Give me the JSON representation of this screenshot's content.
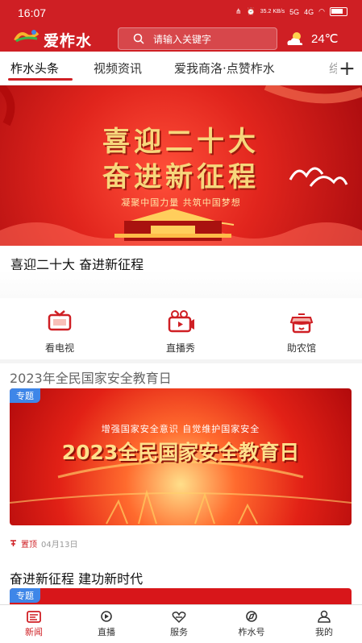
{
  "status": {
    "time": "16:07",
    "network_speed": "35.2 KB/s",
    "network_type": "5G",
    "signal_label": "4G"
  },
  "header": {
    "app_name": "爱柞水",
    "search_placeholder": "请输入关键字",
    "temperature": "24℃"
  },
  "tabs": [
    {
      "label": "柞水头条",
      "active": true
    },
    {
      "label": "视频资讯",
      "active": false
    },
    {
      "label": "爱我商洛·点赞柞水",
      "active": false
    },
    {
      "label": "综",
      "active": false
    }
  ],
  "hero": {
    "title_line_1": "喜迎二十大",
    "title_line_2": "奋进新征程",
    "subtitle": "凝聚中国力量  共筑中国梦想",
    "caption": "喜迎二十大 奋进新征程"
  },
  "quick_links": [
    {
      "label": "看电视",
      "icon": "tv-icon"
    },
    {
      "label": "直播秀",
      "icon": "camera-icon"
    },
    {
      "label": "助农馆",
      "icon": "shop-icon"
    }
  ],
  "feature": {
    "section_title": "2023年全民国家安全教育日",
    "tag": "专题",
    "subtitle": "增强国家安全意识  自觉维护国家安全",
    "title": "2023全民国家安全教育日",
    "pinned_label": "置顶",
    "date": "04月13日"
  },
  "next_item": {
    "title": "奋进新征程 建功新时代",
    "tag": "专题"
  },
  "bottom_nav": [
    {
      "label": "新闻",
      "active": true,
      "icon": "news-icon"
    },
    {
      "label": "直播",
      "active": false,
      "icon": "live-icon"
    },
    {
      "label": "服务",
      "active": false,
      "icon": "service-icon"
    },
    {
      "label": "柞水号",
      "active": false,
      "icon": "compass-icon"
    },
    {
      "label": "我的",
      "active": false,
      "icon": "profile-icon"
    }
  ],
  "colors": {
    "brand": "#CF1F24",
    "tag_blue": "#3E86E8",
    "gold": "#F7D77C"
  }
}
